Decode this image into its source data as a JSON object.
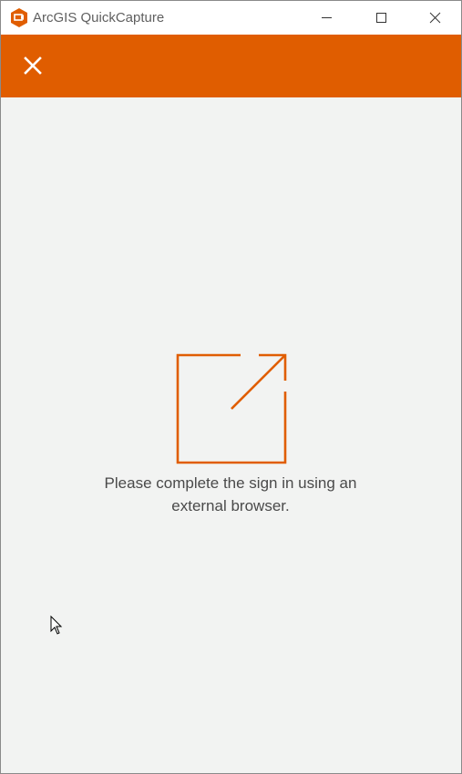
{
  "window": {
    "title": "ArcGIS QuickCapture",
    "controls": {
      "minimize": "minimize-icon",
      "maximize": "maximize-icon",
      "close": "close-icon"
    }
  },
  "appbar": {
    "close_icon": "close-icon",
    "accent_color": "#e05d00"
  },
  "main": {
    "icon": "external-link-icon",
    "message": "Please complete the sign in using an external browser."
  },
  "colors": {
    "brand": "#e05d00",
    "background": "#f2f3f2",
    "text": "#4a4a4a"
  }
}
